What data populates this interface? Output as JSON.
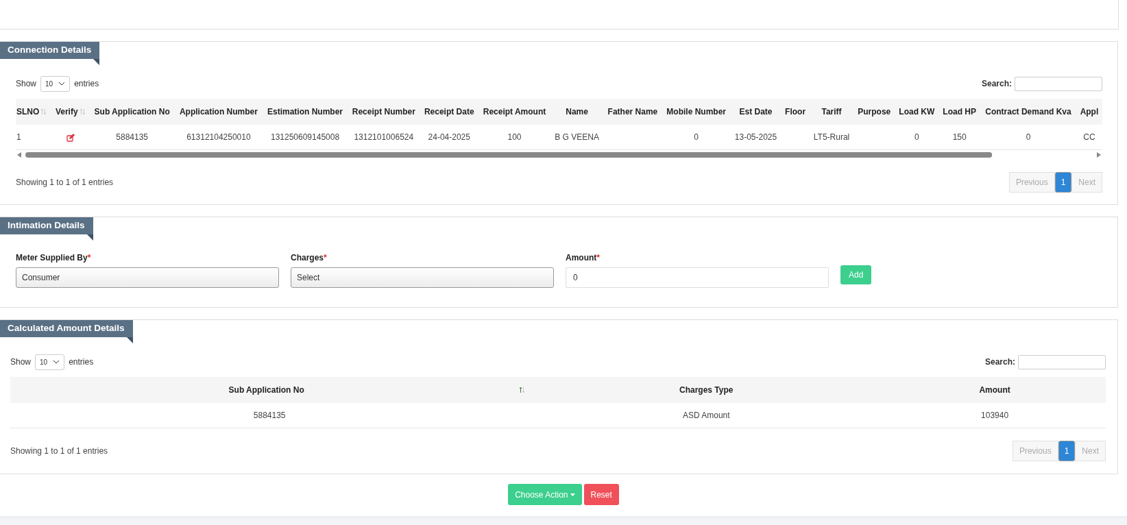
{
  "connection_details": {
    "title": "Connection Details",
    "length": {
      "before": "Show",
      "value": "10",
      "after": "entries"
    },
    "search": {
      "label": "Search:"
    },
    "columns": [
      {
        "label": "SLNO",
        "sortable": true,
        "sorted": false
      },
      {
        "label": "Verify",
        "sortable": true,
        "sorted": false
      },
      {
        "label": "Sub Application No",
        "sortable": false,
        "sorted": false
      },
      {
        "label": "Application Number",
        "sortable": false,
        "sorted": false
      },
      {
        "label": "Estimation Number",
        "sortable": false,
        "sorted": false
      },
      {
        "label": "Receipt Number",
        "sortable": false,
        "sorted": false
      },
      {
        "label": "Receipt Date",
        "sortable": false,
        "sorted": false
      },
      {
        "label": "Receipt Amount",
        "sortable": false,
        "sorted": false
      },
      {
        "label": "Name",
        "sortable": false,
        "sorted": false
      },
      {
        "label": "Father Name",
        "sortable": false,
        "sorted": false
      },
      {
        "label": "Mobile Number",
        "sortable": false,
        "sorted": false
      },
      {
        "label": "Est Date",
        "sortable": false,
        "sorted": false
      },
      {
        "label": "Floor",
        "sortable": false,
        "sorted": false
      },
      {
        "label": "Tariff",
        "sortable": false,
        "sorted": false
      },
      {
        "label": "Purpose",
        "sortable": false,
        "sorted": false
      },
      {
        "label": "Load KW",
        "sortable": false,
        "sorted": false
      },
      {
        "label": "Load HP",
        "sortable": false,
        "sorted": false
      },
      {
        "label": "Contract Demand Kva",
        "sortable": false,
        "sorted": false
      },
      {
        "label": "Appl",
        "sortable": false,
        "sorted": false
      }
    ],
    "rows": [
      [
        {
          "kind": "text",
          "text": "1"
        },
        {
          "kind": "edit"
        },
        {
          "kind": "text",
          "text": "5884135"
        },
        {
          "kind": "text",
          "text": "61312104250010"
        },
        {
          "kind": "text",
          "text": "131250609145008"
        },
        {
          "kind": "text",
          "text": "1312101006524"
        },
        {
          "kind": "text",
          "text": "24-04-2025"
        },
        {
          "kind": "text",
          "text": "100"
        },
        {
          "kind": "text",
          "text": "B G VEENA"
        },
        {
          "kind": "blank"
        },
        {
          "kind": "text",
          "text": "0"
        },
        {
          "kind": "text",
          "text": "13-05-2025"
        },
        {
          "kind": "blank"
        },
        {
          "kind": "text",
          "text": "LT5-Rural"
        },
        {
          "kind": "blank"
        },
        {
          "kind": "text",
          "text": "0"
        },
        {
          "kind": "text",
          "text": "150"
        },
        {
          "kind": "text",
          "text": "0"
        },
        {
          "kind": "text",
          "text": "CC"
        }
      ]
    ],
    "scrollbar": true,
    "info": "Showing 1 to 1 of 1 entries",
    "pagination": {
      "previous": {
        "label": "Previous",
        "disabled": true
      },
      "pages": [
        {
          "label": "1",
          "selected": true
        }
      ],
      "next": {
        "label": "Next",
        "disabled": true
      }
    }
  },
  "intimation_details": {
    "title": "Intimation Details",
    "fields": [
      {
        "kind": "select",
        "label": "Meter Supplied By",
        "required_mark": "*",
        "value": "Consumer"
      },
      {
        "kind": "select",
        "label": "Charges",
        "required_mark": "*",
        "value": "Select"
      },
      {
        "kind": "input",
        "label": "Amount",
        "required_mark": "*",
        "value": "0"
      }
    ],
    "add_button": "Add"
  },
  "calculated_amount_details": {
    "title": "Calculated Amount Details",
    "length": {
      "before": "Show",
      "value": "10",
      "after": "entries"
    },
    "search": {
      "label": "Search:"
    },
    "columns": [
      {
        "label": "Sub Application No",
        "sortable": true,
        "sorted": true
      },
      {
        "label": "Charges Type",
        "sortable": false,
        "sorted": false
      },
      {
        "label": "Amount",
        "sortable": false,
        "sorted": false
      }
    ],
    "rows": [
      [
        {
          "kind": "text",
          "text": "5884135"
        },
        {
          "kind": "text",
          "text": "ASD Amount"
        },
        {
          "kind": "text",
          "text": "103940"
        }
      ]
    ],
    "scrollbar": false,
    "info": "Showing 1 to 1 of 1 entries",
    "pagination": {
      "previous": {
        "label": "Previous",
        "disabled": true
      },
      "pages": [
        {
          "label": "1",
          "selected": true
        }
      ],
      "next": {
        "label": "Next",
        "disabled": true
      }
    }
  },
  "actions": [
    {
      "kind": "dropdown",
      "label": "Choose Action"
    },
    {
      "kind": "danger",
      "label": "Reset"
    }
  ]
}
